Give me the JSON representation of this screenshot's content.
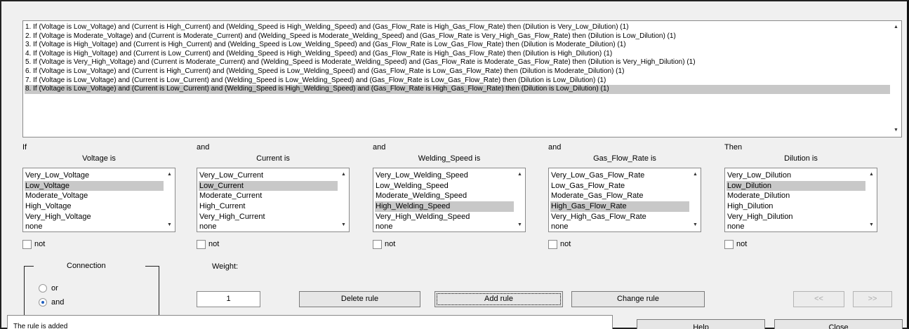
{
  "rules": {
    "items": [
      "1. If (Voltage is Low_Voltage) and (Current is High_Current) and (Welding_Speed is High_Welding_Speed) and (Gas_Flow_Rate is High_Gas_Flow_Rate) then (Dilution is Very_Low_Dilution) (1)",
      "2. If (Voltage is Moderate_Voltage) and (Current is Moderate_Current) and (Welding_Speed is Moderate_Welding_Speed) and (Gas_Flow_Rate is Very_High_Gas_Flow_Rate) then (Dilution is Low_Dilution) (1)",
      "3. If (Voltage is High_Voltage) and (Current is High_Current) and (Welding_Speed is Low_Welding_Speed) and (Gas_Flow_Rate is Low_Gas_Flow_Rate) then (Dilution is Moderate_Dilution) (1)",
      "4. If (Voltage is High_Voltage) and (Current is Low_Current) and (Welding_Speed is High_Welding_Speed) and (Gas_Flow_Rate is High_Gas_Flow_Rate) then (Dilution is High_Dilution) (1)",
      "5. If (Voltage is Very_High_Voltage) and (Current is Moderate_Current) and (Welding_Speed is Moderate_Welding_Speed) and (Gas_Flow_Rate is Moderate_Gas_Flow_Rate) then (Dilution is Very_High_Dilution) (1)",
      "6. If (Voltage is Low_Voltage) and (Current is High_Current) and (Welding_Speed is Low_Welding_Speed) and (Gas_Flow_Rate is Low_Gas_Flow_Rate) then (Dilution is Moderate_Dilution) (1)",
      "7. If (Voltage is Low_Voltage) and (Current is Low_Current) and (Welding_Speed is Low_Welding_Speed) and (Gas_Flow_Rate is Low_Gas_Flow_Rate) then (Dilution is Low_Dilution) (1)",
      "8. If (Voltage is Low_Voltage) and (Current is Low_Current) and (Welding_Speed is High_Welding_Speed) and (Gas_Flow_Rate is High_Gas_Flow_Rate) then (Dilution is Low_Dilution) (1)"
    ],
    "selected_index": 7
  },
  "columns": [
    {
      "keyword": "If",
      "title": "Voltage is",
      "options": [
        "Very_Low_Voltage",
        "Low_Voltage",
        "Moderate_Voltage",
        "High_Voltage",
        "Very_High_Voltage",
        "none"
      ],
      "selected_index": 1,
      "not_label": "not"
    },
    {
      "keyword": "and",
      "title": "Current is",
      "options": [
        "Very_Low_Current",
        "Low_Current",
        "Moderate_Current",
        "High_Current",
        "Very_High_Current",
        "none"
      ],
      "selected_index": 1,
      "not_label": "not"
    },
    {
      "keyword": "and",
      "title": "Welding_Speed is",
      "options": [
        "Very_Low_Welding_Speed",
        "Low_Welding_Speed",
        "Moderate_Welding_Speed",
        "High_Welding_Speed",
        "Very_High_Welding_Speed",
        "none"
      ],
      "selected_index": 3,
      "not_label": "not"
    },
    {
      "keyword": "and",
      "title": "Gas_Flow_Rate is",
      "options": [
        "Very_Low_Gas_Flow_Rate",
        "Low_Gas_Flow_Rate",
        "Moderate_Gas_Flow_Rate",
        "High_Gas_Flow_Rate",
        "Very_High_Gas_Flow_Rate",
        "none"
      ],
      "selected_index": 3,
      "not_label": "not"
    },
    {
      "keyword": "Then",
      "title": "Dilution is",
      "options": [
        "Very_Low_Dilution",
        "Low_Dilution",
        "Moderate_Dilution",
        "High_Dilution",
        "Very_High_Dilution",
        "none"
      ],
      "selected_index": 1,
      "not_label": "not"
    }
  ],
  "connection": {
    "label": "Connection",
    "or_label": "or",
    "and_label": "and",
    "selected": "and"
  },
  "weight": {
    "label": "Weight:",
    "value": "1"
  },
  "buttons": {
    "delete": "Delete rule",
    "add": "Add rule",
    "change": "Change rule",
    "prev": "<<",
    "next": ">>",
    "help": "Help",
    "close": "Close"
  },
  "status": "The rule is added",
  "icons": {
    "scroll_up": "scroll-up-arrow-icon",
    "scroll_down": "scroll-down-arrow-icon"
  },
  "colors": {
    "selection": "#c8c8c8",
    "window_bg": "#f0f0f0",
    "radio_dot": "#1f5fbf"
  }
}
